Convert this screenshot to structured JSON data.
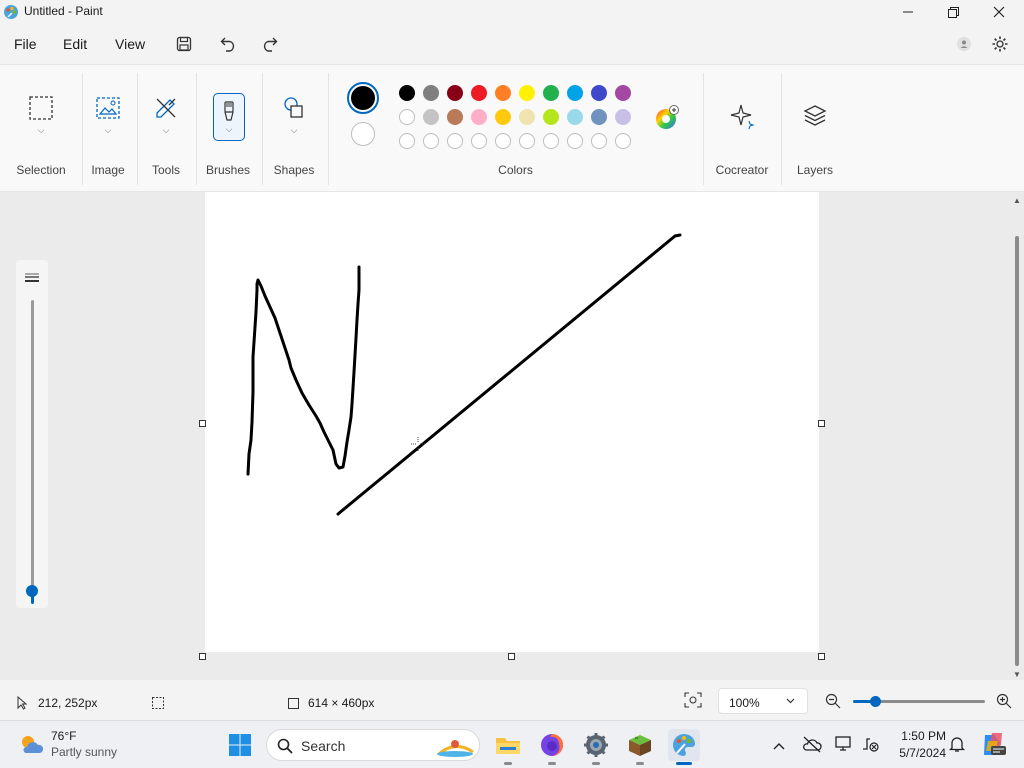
{
  "window": {
    "title": "Untitled - Paint",
    "controls": [
      "minimize-icon",
      "maximize-icon",
      "close-icon"
    ]
  },
  "menu": {
    "items": [
      "File",
      "Edit",
      "View"
    ],
    "quick_actions": [
      "save-icon",
      "undo-icon",
      "redo-icon"
    ]
  },
  "ribbon": {
    "groups": {
      "selection": "Selection",
      "image": "Image",
      "tools": "Tools",
      "brushes": "Brushes",
      "shapes": "Shapes",
      "colors": "Colors",
      "cocreator": "Cocreator",
      "layers": "Layers"
    },
    "color1": "#000000",
    "color2": "#ffffff",
    "palette_row1": [
      "#000000",
      "#7f7f7f",
      "#880015",
      "#ed1c24",
      "#ff7f27",
      "#fff200",
      "#22b14c",
      "#00a2e8",
      "#3f48cc",
      "#a349a4"
    ],
    "palette_row2": [
      "#ffffff",
      "#c3c3c3",
      "#b97a57",
      "#ffaec9",
      "#ffc90e",
      "#efe4b0",
      "#b5e61d",
      "#99d9ea",
      "#7092be",
      "#c8bfe7"
    ],
    "palette_row3_count": 10
  },
  "status": {
    "cursor_position": "212, 252px",
    "canvas_size": "614 × 460px",
    "zoom": "100%"
  },
  "taskbar": {
    "weather_temp": "76°F",
    "weather_desc": "Partly sunny",
    "search_placeholder": "Search",
    "time": "1:50 PM",
    "date": "5/7/2024"
  }
}
